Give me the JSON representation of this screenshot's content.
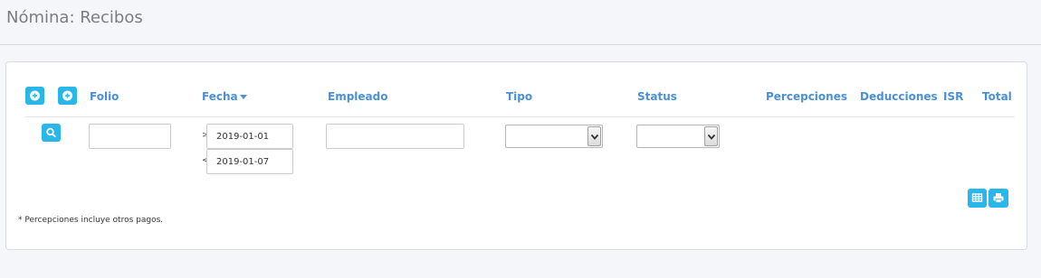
{
  "page": {
    "title": "Nómina: Recibos"
  },
  "header": {
    "columns": {
      "folio": "Folio",
      "fecha": "Fecha",
      "empleado": "Empleado",
      "tipo": "Tipo",
      "status": "Status",
      "percepciones": "Percepciones",
      "deducciones": "Deducciones",
      "isr": "ISR",
      "total": "Total"
    },
    "sort_column": "Fecha",
    "sort_direction": "descending"
  },
  "filters": {
    "folio": "",
    "fecha_from_operator": ">",
    "fecha_from": "2019-01-01",
    "fecha_to_operator": "<",
    "fecha_to": "2019-01-07",
    "empleado": "",
    "tipo": "",
    "status": ""
  },
  "footnote": "* Percepciones incluye otros pagos.",
  "icons": {
    "add_1": "plus-circle-icon",
    "add_2": "plus-circle-icon",
    "search": "search-icon",
    "export": "table-icon",
    "print": "print-icon"
  },
  "colors": {
    "accent": "#29b6e8",
    "header_text": "#4a90d9",
    "title_text": "#7d7d7d"
  }
}
